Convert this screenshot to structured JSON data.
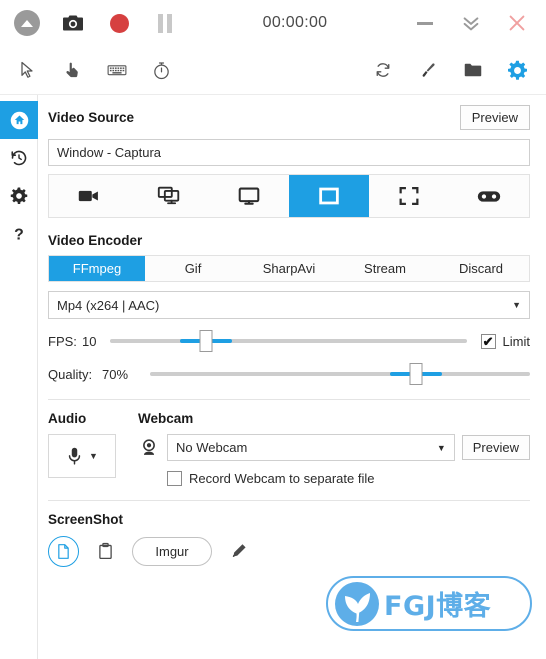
{
  "titlebar": {
    "timer": "00:00:00",
    "buttons": {
      "tray": "tray-arrow",
      "screenshot": "camera",
      "record": "record",
      "pause": "pause",
      "minimize": "minimize",
      "collapse": "collapse",
      "close": "close"
    }
  },
  "toolbar": {
    "left_items": [
      {
        "name": "cursor-icon",
        "title": "Include Cursor"
      },
      {
        "name": "click-icon",
        "title": "Include Clicks"
      },
      {
        "name": "keyboard-icon",
        "title": "Include Keystrokes"
      },
      {
        "name": "timer-icon",
        "title": "Delay / Duration"
      }
    ],
    "right_items": [
      {
        "name": "refresh-icon",
        "title": "Refresh"
      },
      {
        "name": "brush-icon",
        "title": "Image Editor"
      },
      {
        "name": "folder-icon",
        "title": "Open Output Folder"
      },
      {
        "name": "gear-icon",
        "title": "Settings"
      }
    ]
  },
  "sidebar": {
    "items": [
      {
        "name": "home",
        "label": "Home",
        "active": true
      },
      {
        "name": "history",
        "label": "Recent",
        "active": false
      },
      {
        "name": "settings",
        "label": "Configure",
        "active": false
      },
      {
        "name": "about",
        "label": "About",
        "active": false
      }
    ]
  },
  "video_source": {
    "title": "Video Source",
    "preview_label": "Preview",
    "value": "Window  -  Captura",
    "types": [
      {
        "name": "no-video-icon",
        "label": "No Video",
        "active": false
      },
      {
        "name": "full-screen-icon",
        "label": "Full Screen",
        "active": false
      },
      {
        "name": "screen-icon",
        "label": "Screen",
        "active": false
      },
      {
        "name": "window-icon",
        "label": "Window",
        "active": true
      },
      {
        "name": "region-icon",
        "label": "Region",
        "active": false
      },
      {
        "name": "gamepad-icon",
        "label": "Game / DeskDupl",
        "active": false
      }
    ]
  },
  "video_encoder": {
    "title": "Video Encoder",
    "tabs": [
      {
        "label": "FFmpeg",
        "active": true
      },
      {
        "label": "Gif",
        "active": false
      },
      {
        "label": "SharpAvi",
        "active": false
      },
      {
        "label": "Stream",
        "active": false
      },
      {
        "label": "Discard",
        "active": false
      }
    ],
    "codec": "Mp4 (x264 | AAC)",
    "fps": {
      "label": "FPS:",
      "value": "10",
      "percent": 27
    },
    "quality": {
      "label": "Quality:",
      "value": "70%",
      "percent": 70
    },
    "limit": {
      "label": "Limit",
      "checked": true,
      "tick": "✔"
    }
  },
  "audio": {
    "title": "Audio",
    "source_icon": "microphone-icon"
  },
  "webcam": {
    "title": "Webcam",
    "value": "No Webcam",
    "preview_label": "Preview",
    "record_separate": {
      "label": "Record Webcam to separate file",
      "checked": false
    }
  },
  "screenshot": {
    "title": "ScreenShot",
    "disk_icon": "file-icon",
    "clipboard_icon": "clipboard-icon",
    "imgur_label": "Imgur",
    "edit_icon": "pencil-icon"
  },
  "watermark": {
    "text": "FGJ博客"
  },
  "colors": {
    "accent": "#1e9fe3",
    "record": "#d64040",
    "close": "#f0a0a0",
    "watermark": "#5eaee8"
  }
}
